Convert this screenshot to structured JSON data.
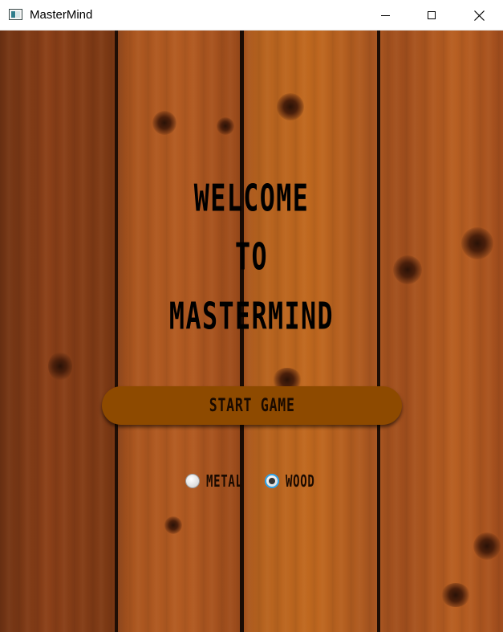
{
  "window": {
    "title": "MasterMind",
    "icon": "app-window-icon",
    "controls": [
      "minimize-icon",
      "maximize-icon",
      "close-icon"
    ]
  },
  "welcome": {
    "line1": "WELCOME",
    "line2": "TO",
    "line3": "MASTERMIND"
  },
  "start_button": {
    "label": "START GAME",
    "color": "#8e4a00"
  },
  "theme_options": {
    "metal_label": "METAL",
    "metal_selected": false,
    "wood_label": "WOOD",
    "wood_selected": true,
    "accent": "#2fa3e8"
  }
}
